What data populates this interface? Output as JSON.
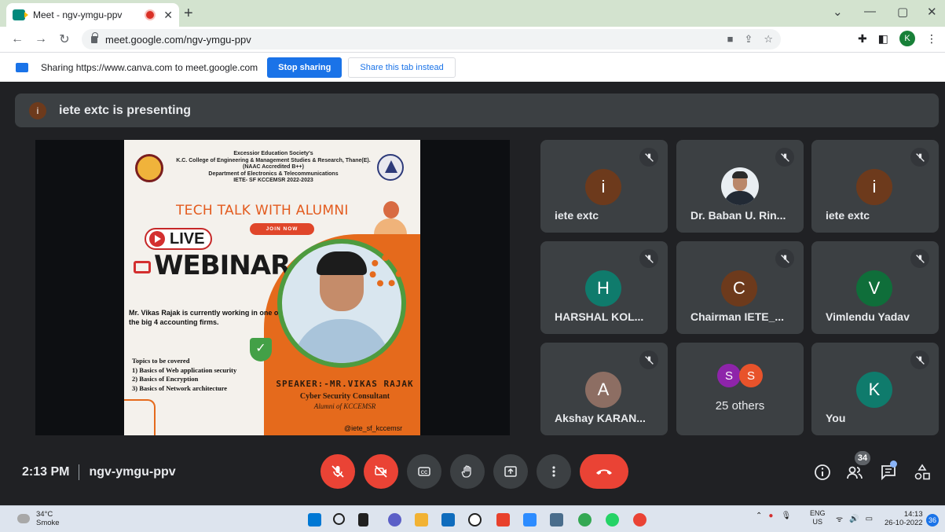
{
  "browser": {
    "tab_title": "Meet - ngv-ymgu-ppv",
    "tab_close": "✕",
    "new_tab": "+",
    "url": "meet.google.com/ngv-ymgu-ppv",
    "profile_initial": "K"
  },
  "sharebar": {
    "message": "Sharing https://www.canva.com to meet.google.com",
    "stop_label": "Stop sharing",
    "share_tab_label": "Share this tab instead"
  },
  "presenting": {
    "avatar_initial": "i",
    "text": "iete extc is presenting"
  },
  "poster": {
    "org_line1": "Excessior Education Society's",
    "org_line2": "K.C. College of Engineering & Management Studies & Research, Thane(E).",
    "org_line3": "(NAAC Accredited B++)",
    "org_line4": "Department of Electronics & Telecommunications",
    "org_line5": "IETE- SF KCCEMSR 2022-2023",
    "headline": "TECH TALK WITH ALUMNI",
    "join_now": "JOIN NOW",
    "live": "LIVE",
    "webinar": "WEBINAR",
    "intro": "Mr. Vikas Rajak is currently working in one of the big 4 accounting firms.",
    "topics_title": "Topics to be covered",
    "topic1": "1) Basics of Web application security",
    "topic2": "2) Basics of Encryption",
    "topic3": "3) Basics of Network architecture",
    "speaker": "SPEAKER:-MR.VIKAS RAJAK",
    "role": "Cyber Security Consultant",
    "alumni": "Alumni of KCCEMSR",
    "handle": "@iete_sf_kccemsr"
  },
  "participants": [
    {
      "name": "iete extc",
      "initial": "i",
      "color": "#6d3a1c"
    },
    {
      "name": "Dr. Baban U. Rin...",
      "initial": "",
      "color": ""
    },
    {
      "name": "iete extc",
      "initial": "i",
      "color": "#6d3a1c"
    },
    {
      "name": "HARSHAL KOL...",
      "initial": "H",
      "color": "#0f7b6c"
    },
    {
      "name": "Chairman IETE_...",
      "initial": "C",
      "color": "#6d3a1c"
    },
    {
      "name": "Vimlendu Yadav",
      "initial": "V",
      "color": "#0f6e3a"
    },
    {
      "name": "Akshay KARAN...",
      "initial": "A",
      "color": "#8d6e63"
    },
    {
      "name": "25 others",
      "initials": [
        "S",
        "S"
      ],
      "colors": [
        "#8e24aa",
        "#e8532b"
      ]
    },
    {
      "name": "You",
      "initial": "K",
      "color": "#0f7b6c"
    }
  ],
  "meetbar": {
    "time": "2:13 PM",
    "meeting_code": "ngv-ymgu-ppv",
    "people_count": "34"
  },
  "taskbar": {
    "temperature": "34°C",
    "weather": "Smoke",
    "lang1": "ENG",
    "lang2": "US",
    "time": "14:13",
    "date": "26-10-2022",
    "notifications": "36"
  }
}
